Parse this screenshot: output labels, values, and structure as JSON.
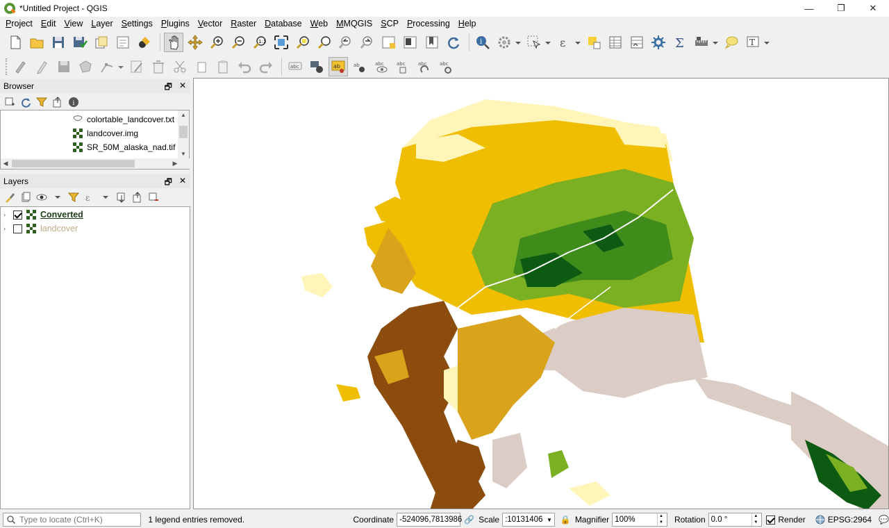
{
  "window": {
    "title": "*Untitled Project - QGIS",
    "controls": {
      "minimize": "—",
      "restore": "❐",
      "close": "✕"
    }
  },
  "menubar": {
    "items": [
      "Project",
      "Edit",
      "View",
      "Layer",
      "Settings",
      "Plugins",
      "Vector",
      "Raster",
      "Database",
      "Web",
      "MMQGIS",
      "SCP",
      "Processing",
      "Help"
    ]
  },
  "toolbar1": {
    "buttons": [
      "new-project",
      "open-project",
      "save-project",
      "save-as",
      "print-layout",
      "layout-manager",
      "style-manager",
      "pan",
      "pan-to-selection",
      "zoom-in",
      "zoom-out",
      "zoom-native",
      "zoom-full",
      "zoom-to-selection",
      "zoom-to-layer",
      "zoom-last",
      "zoom-next",
      "new-map-view",
      "new-3d-view",
      "new-bookmark",
      "refresh",
      "identify",
      "run-feature-action",
      "select-features",
      "deselect",
      "open-attribute-table",
      "field-calculator",
      "processing-toolbox",
      "statistics",
      "measure",
      "annotation",
      "text-annotation"
    ]
  },
  "toolbar2": {
    "buttons": [
      "edits",
      "toggle-editing",
      "save-edits",
      "digitize",
      "vertex-tool",
      "modify-attributes",
      "delete-selected",
      "cut-features",
      "copy-features",
      "paste-features",
      "undo",
      "redo",
      "label-tool",
      "pin-labels",
      "highlight-labels",
      "move-label",
      "rotate-label",
      "change-label",
      "show-hide-labels"
    ]
  },
  "browser": {
    "title": "Browser",
    "files": [
      {
        "name": "colortable_landcover.txt",
        "icon": "text-file-icon"
      },
      {
        "name": "landcover.img",
        "icon": "raster-icon"
      },
      {
        "name": "SR_50M_alaska_nad.tif",
        "icon": "raster-icon"
      }
    ]
  },
  "layers": {
    "title": "Layers",
    "items": [
      {
        "name": "Converted",
        "checked": true
      },
      {
        "name": "landcover",
        "checked": false
      }
    ]
  },
  "map": {
    "colors": {
      "tundra_light": "#fff5b8",
      "shrub": "#f0be00",
      "shrub_dark": "#d9a41c",
      "forest_light": "#7bb023",
      "forest_mid": "#3f8c1a",
      "forest_dark": "#0d5a13",
      "barren_brown": "#8b4c0e",
      "rock_ice": "#dcccc6",
      "water": "#ffffff"
    }
  },
  "statusbar": {
    "locate_placeholder": "Type to locate (Ctrl+K)",
    "message": "1 legend entries removed.",
    "coordinate_label": "Coordinate",
    "coordinate_value": "-524096,7813986",
    "scale_label": "Scale",
    "scale_value": ":10131406",
    "magnifier_label": "Magnifier",
    "magnifier_value": "100%",
    "rotation_label": "Rotation",
    "rotation_value": "0.0 °",
    "render_label": "Render",
    "render_checked": true,
    "crs": "EPSG:2964"
  }
}
